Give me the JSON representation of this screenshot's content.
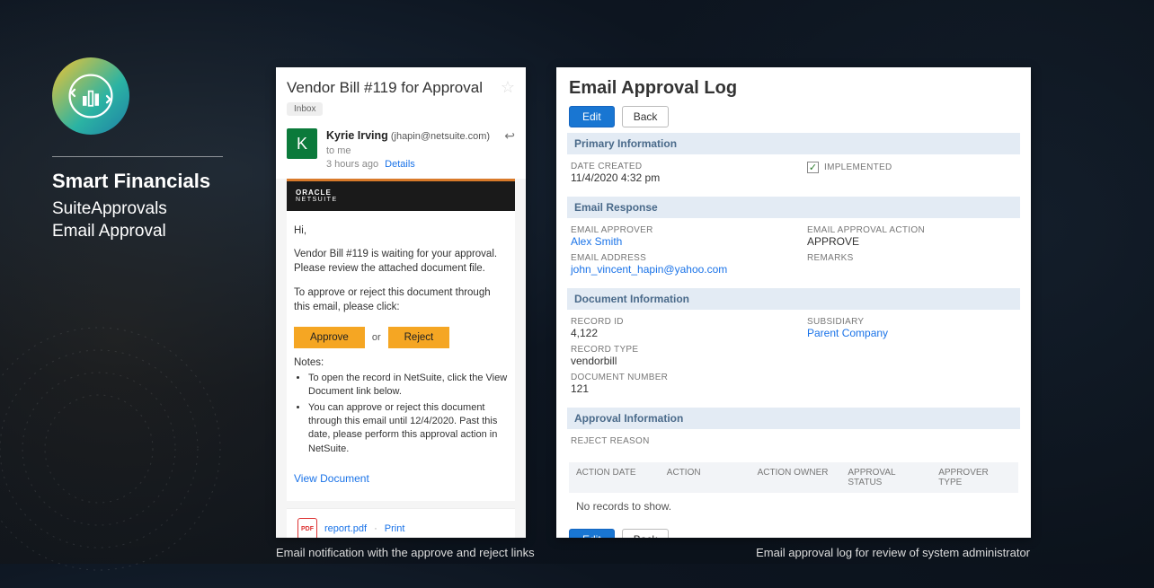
{
  "slide": {
    "title": "Smart Financials",
    "subtitle1": "SuiteApprovals",
    "subtitle2": "Email Approval",
    "caption_left": "Email notification with the approve and reject links",
    "caption_right": "Email approval log for review of system administrator"
  },
  "email": {
    "subject": "Vendor Bill #119 for Approval",
    "inbox_label": "Inbox",
    "avatar_letter": "K",
    "sender_name": "Kyrie Irving",
    "sender_email": "(jhapin@netsuite.com)",
    "to_line": "to me",
    "time": "3 hours ago",
    "details": "Details",
    "brand_top": "ORACLE",
    "brand_bottom": "NETSUITE",
    "greeting": "Hi,",
    "para1": "Vendor Bill #119 is waiting for your approval. Please review the attached document file.",
    "para2": "To approve or reject this document through this email, please click:",
    "approve": "Approve",
    "or": "or",
    "reject": "Reject",
    "notes_label": "Notes:",
    "note1": "To open the record in NetSuite, click the View Document link below.",
    "note2": "You can approve or reject this document through this email until 12/4/2020. Past this date, please perform this approval action in NetSuite.",
    "view_document": "View Document",
    "pdf_label": "PDF",
    "attachment": "report.pdf",
    "print": "Print"
  },
  "log": {
    "title": "Email Approval Log",
    "edit": "Edit",
    "back": "Back",
    "sections": {
      "primary": "Primary Information",
      "response": "Email Response",
      "document": "Document Information",
      "approval": "Approval Information"
    },
    "primary": {
      "date_created_label": "DATE CREATED",
      "date_created": "11/4/2020 4:32 pm",
      "implemented_label": "IMPLEMENTED"
    },
    "response": {
      "approver_label": "EMAIL APPROVER",
      "approver": "Alex Smith",
      "address_label": "EMAIL ADDRESS",
      "address": "john_vincent_hapin@yahoo.com",
      "action_label": "EMAIL APPROVAL ACTION",
      "action": "APPROVE",
      "remarks_label": "REMARKS"
    },
    "document": {
      "record_id_label": "RECORD ID",
      "record_id": "4,122",
      "record_type_label": "RECORD TYPE",
      "record_type": "vendorbill",
      "doc_num_label": "DOCUMENT NUMBER",
      "doc_num": "121",
      "subsidiary_label": "SUBSIDIARY",
      "subsidiary": "Parent Company"
    },
    "approval": {
      "reject_reason_label": "REJECT REASON"
    },
    "table": {
      "col1": "ACTION DATE",
      "col2": "ACTION",
      "col3": "ACTION OWNER",
      "col4": "APPROVAL STATUS",
      "col5": "APPROVER TYPE",
      "empty": "No records to show."
    }
  }
}
